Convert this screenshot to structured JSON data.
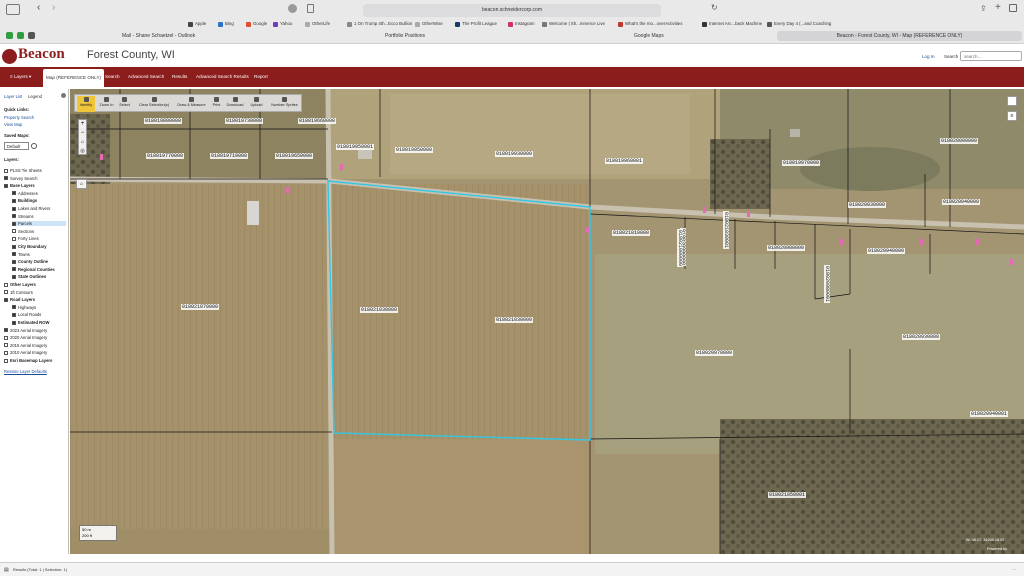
{
  "browser": {
    "url": "beacon.schneidercorp.com",
    "bookmarks": [
      "Apple",
      "Bing",
      "Google",
      "Yahoo",
      "OtherLife",
      "1 On Trump 4th...Ecco Bullion",
      "OtherWise",
      "The Profit League",
      "Instagram",
      "Welcome | Sh...mmerce Live",
      "What's the mo...overActivities",
      "Internet Arc...back Machine",
      "Every Day 4 (...and Coaching"
    ],
    "tabs": [
      "Mail - Shane Schaetzel - Outlook",
      "Portfolio Positions",
      "Google Maps",
      "Beacon - Forest County, WI - Map (REFERENCE ONLY)"
    ]
  },
  "header": {
    "brand": "Beacon",
    "county": "Forest County, WI",
    "login": "Log In",
    "search_label": "Search",
    "search_placeholder": "search..."
  },
  "nav": {
    "layers": "Layers",
    "items": [
      "Map (REFERENCE ONLY)",
      "Search",
      "Advanced Search",
      "Results",
      "Advanced Search Results",
      "Report"
    ]
  },
  "sidebar": {
    "tabs": [
      "Layer List",
      "Legend"
    ],
    "quick_links_label": "Quick Links:",
    "quick_links": [
      "Property Search",
      "View Map"
    ],
    "saved_maps_label": "Saved Maps:",
    "saved_maps_value": "Default",
    "layers_label": "Layers:",
    "layers": [
      {
        "label": "PLSS Tie Sheets",
        "checked": false,
        "indent": 0
      },
      {
        "label": "Survey Search",
        "checked": true,
        "indent": 0
      },
      {
        "label": "Base Layers",
        "checked": true,
        "indent": 0,
        "bold": true
      },
      {
        "label": "Addresses",
        "checked": true,
        "indent": 1
      },
      {
        "label": "Buildings",
        "checked": true,
        "indent": 1,
        "bold": true
      },
      {
        "label": "Lakes and Rivers",
        "checked": true,
        "indent": 1
      },
      {
        "label": "Streams",
        "checked": true,
        "indent": 1
      },
      {
        "label": "Parcels",
        "checked": true,
        "indent": 1,
        "selected": true
      },
      {
        "label": "Sections",
        "checked": false,
        "indent": 1
      },
      {
        "label": "Forty Lines",
        "checked": false,
        "indent": 1
      },
      {
        "label": "City Boundary",
        "checked": true,
        "indent": 1,
        "bold": true
      },
      {
        "label": "Towns",
        "checked": true,
        "indent": 1
      },
      {
        "label": "County Outline",
        "checked": true,
        "indent": 1,
        "bold": true
      },
      {
        "label": "Regional Counties",
        "checked": true,
        "indent": 1,
        "bold": true
      },
      {
        "label": "State Outlines",
        "checked": true,
        "indent": 1,
        "bold": true
      },
      {
        "label": "Other Layers",
        "checked": false,
        "indent": 0,
        "bold": true
      },
      {
        "label": "1ft Contours",
        "checked": false,
        "indent": 0
      },
      {
        "label": "Road Layers",
        "checked": true,
        "indent": 0,
        "bold": true
      },
      {
        "label": "Highways",
        "checked": true,
        "indent": 1
      },
      {
        "label": "Local Roads",
        "checked": true,
        "indent": 1
      },
      {
        "label": "Estimated ROW",
        "checked": true,
        "indent": 1,
        "bold": true
      },
      {
        "label": "2023 Aerial Imagery",
        "checked": true,
        "indent": 0
      },
      {
        "label": "2020 Aerial Imagery",
        "checked": false,
        "indent": 0
      },
      {
        "label": "2015 Aerial Imagery",
        "checked": false,
        "indent": 0
      },
      {
        "label": "2010 Aerial Imagery",
        "checked": false,
        "indent": 0
      },
      {
        "label": "Esri Basemap Layers",
        "checked": false,
        "indent": 0,
        "bold": true
      }
    ],
    "restore_link": "Restore Layer Defaults"
  },
  "toolbar": {
    "tools": [
      "Identify",
      "Zoom In",
      "Select",
      "Clear Selection(s)",
      "Draw & Measure",
      "Print",
      "Download",
      "Upload",
      "Number Sprites"
    ]
  },
  "map": {
    "parcels": [
      "018019800000",
      "018019730000",
      "018019660000",
      "018019770000",
      "018019710000",
      "018019650000",
      "018019950001",
      "018019950000",
      "018019930000",
      "018019960001",
      "018019970000",
      "018020000000",
      "018020030000",
      "018020040000",
      "018021010000",
      "018020980000",
      "018020940000",
      "018021070000",
      "018021030000",
      "018021030000",
      "018020970000",
      "018020930000",
      "018020940001",
      "018021050001",
      "018020990000",
      "018021030001",
      "018020980001",
      "018021000000"
    ],
    "scale_metric": "50 m",
    "scale_imperial": "200 ft",
    "coords": "W: 48.17, 34208.18.02",
    "powered_by": "Powered by"
  },
  "status": {
    "results": "Results (Total: 1 | Selection: 1)"
  },
  "colors": {
    "brand": "#8c1d1d",
    "selection": "#33c7e6",
    "parcel_line": "#000000"
  }
}
